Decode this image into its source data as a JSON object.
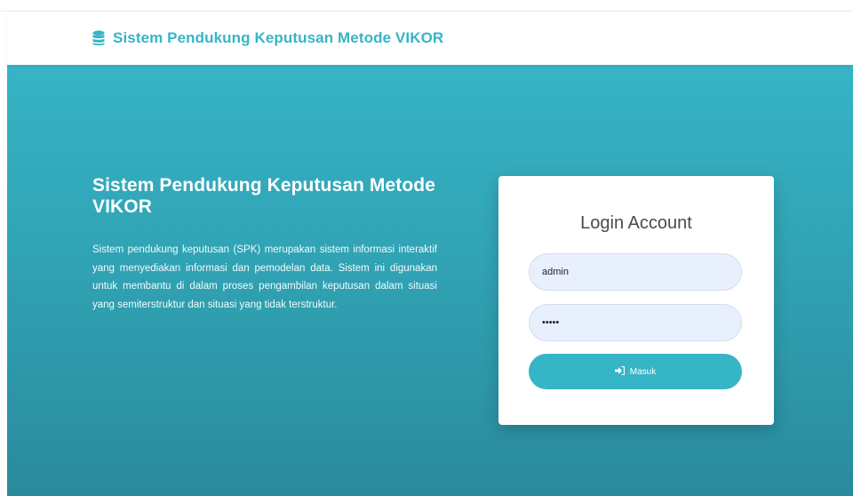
{
  "navbar": {
    "brand_icon": "database-icon",
    "brand_title": "Sistem Pendukung Keputusan Metode VIKOR",
    "brand_color": "#35b5c6"
  },
  "hero": {
    "gradient_top": "#36b4c6",
    "gradient_bottom": "#2a8a9c",
    "title": "Sistem Pendukung Keputusan Metode VIKOR",
    "description": "Sistem pendukung keputusan (SPK) merupakan sistem informasi interaktif yang menyediakan informasi dan pemodelan data. Sistem ini digunakan untuk membantu di dalam proses pengambilan keputusan dalam situasi yang semiterstruktur dan situasi yang tidak terstruktur."
  },
  "login": {
    "title": "Login Account",
    "username_value": "admin",
    "password_value": "admin",
    "submit_icon": "sign-in-icon",
    "submit_label": "Masuk",
    "button_color": "#35b5c6",
    "input_bg": "#e8f0fe"
  }
}
